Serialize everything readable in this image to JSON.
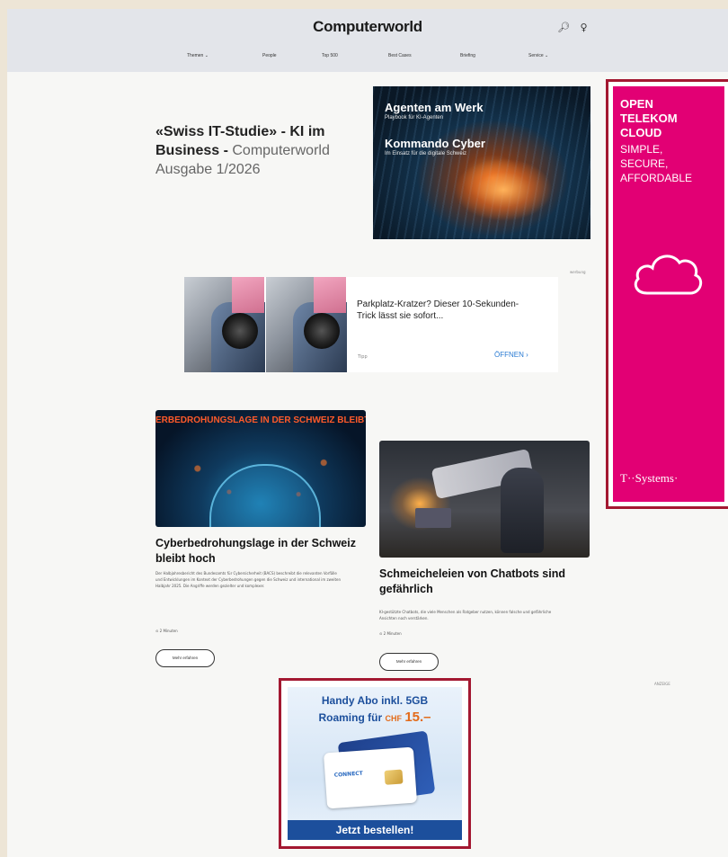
{
  "header": {
    "logo": "Computerworld",
    "icons": [
      "search-icon",
      "user-icon"
    ],
    "nav": [
      "Themen ⌄",
      "People",
      "Top 500",
      "Best Cases",
      "Briefing",
      "Service ⌄"
    ]
  },
  "hero": {
    "title_bold": "«Swiss IT-Studie» - KI im Business - ",
    "title_light": "Computerworld Ausgabe 1/2026",
    "image_title1": "Agenten am Werk",
    "image_sub1": "Playbook für KI-Agenten",
    "image_title2": "Kommando Cyber",
    "image_sub2": "Im Einsatz für die digitale Schweiz"
  },
  "ads": {
    "label_top": "werbung",
    "label_mid": "ANZEIGE",
    "telekom_line1": "OPEN\nTELEKOM\nCLOUD",
    "telekom_line2": "SIMPLE,\nSECURE,\nAFFORDABLE",
    "telekom_logo": "T··Systems·",
    "native_text": "Parkplatz-Kratzer? Dieser 10-Sekunden-Trick lässt sie sofort...",
    "native_source": "Tipp",
    "native_cta": "ÖFFNEN ›",
    "abo_line1": "Handy Abo inkl. 5GB",
    "abo_line2": "Roaming für",
    "abo_currency": "CHF",
    "abo_price": "15.–",
    "abo_card_text": "CONNECT",
    "abo_cta": "Jetzt bestellen!"
  },
  "cards": [
    {
      "banner": "ERBEDROHUNGSLAGE IN DER SCHWEIZ BLEIBT H",
      "title": "Cyberbedrohungslage in der Schweiz bleibt hoch",
      "text": "Der Halbjahresbericht des Bundesamts für Cybersicherheit (BACS) beschreibt die relevanten Vorfälle und Entwicklungen im Kontext der Cyberbedrohungen gegen die Schweiz und international im zweiten Halbjahr 2025. Die Angriffe werden gezielter und komplexer.",
      "meta": "⊙ 2 Minuten",
      "button": "Mehr erfahren"
    },
    {
      "title": "Schmeicheleien von Chatbots sind gefährlich",
      "text": "KI-gestützte Chatbots, die viele Menschen als Ratgeber nutzen, können falsche und gefährliche Ansichten noch verstärken.",
      "meta": "⊙ 2 Minuten",
      "button": "Mehr erfahren"
    }
  ]
}
